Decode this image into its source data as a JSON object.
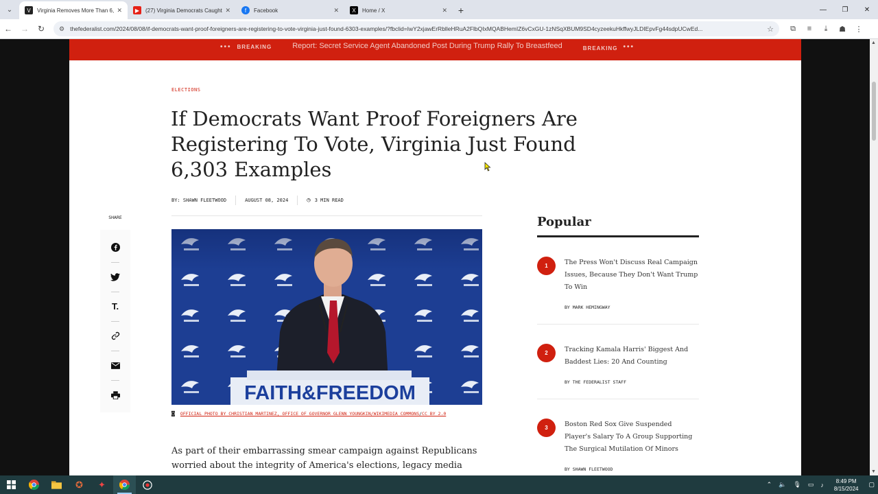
{
  "browser": {
    "tabs": [
      {
        "label": "Virginia Removes More Than 6,",
        "favicon": "V",
        "color": "#222222",
        "active": true
      },
      {
        "label": "(27) Virginia Democrats Caught",
        "favicon": "▶",
        "color": "#e62117",
        "active": false
      },
      {
        "label": "Facebook",
        "favicon": "f",
        "color": "#1877f2",
        "active": false
      },
      {
        "label": "Home / X",
        "favicon": "X",
        "color": "#000000",
        "active": false
      }
    ],
    "url": "thefederalist.com/2024/08/08/if-democrats-want-proof-foreigners-are-registering-to-vote-virginia-just-found-6303-examples/?fbclid=IwY2xjawErRblleHRuA2FlbQIxMQABHemIZ6vCxGU-1zNSqXBUM9SD4cyzeekuHkffwyJLDIEpvFg44sdpUCwEd..."
  },
  "breaking": {
    "dots": "•••",
    "label": "BREAKING",
    "headline": "Report: Secret Service Agent Abandoned Post During Trump Rally To Breastfeed"
  },
  "article": {
    "category": "ELECTIONS",
    "title": "If Democrats Want Proof Foreigners Are Registering To Vote, Virginia Just Found 6,303 Examples",
    "byline": "BY: SHAWN FLEETWOOD",
    "date": "AUGUST 08, 2024",
    "read_time": "3 MIN READ",
    "caption_link1": "OFFICIAL PHOTO BY CHRISTIAN MARTINEZ, OFFICE OF GOVERNOR GLENN YOUNGKIN/WIKIMEDIA COMMONS",
    "caption_sep": "/",
    "caption_link2": "CC BY 2.0",
    "podium_text": "FAITH&FREEDOM",
    "body": "As part of their embarrassing smear campaign against Republicans worried about the integrity of America's elections, legacy media have twisted"
  },
  "share": {
    "label": "SHARE"
  },
  "popular": {
    "heading": "Popular",
    "items": [
      {
        "num": "1",
        "title": "The Press Won't Discuss Real Campaign Issues, Because They Don't Want Trump To Win",
        "author": "BY MARK HEMINGWAY"
      },
      {
        "num": "2",
        "title": "Tracking Kamala Harris' Biggest And Baddest Lies: 20 And Counting",
        "author": "BY THE FEDERALIST STAFF"
      },
      {
        "num": "3",
        "title": "Boston Red Sox Give Suspended Player's Salary To A Group Supporting The Surgical Mutilation Of Minors",
        "author": "BY SHAWN FLEETWOOD"
      }
    ]
  },
  "taskbar": {
    "time": "8:49 PM",
    "date": "8/15/2024"
  },
  "colors": {
    "accent_red": "#d0200f",
    "taskbar": "#1f3b3f"
  }
}
